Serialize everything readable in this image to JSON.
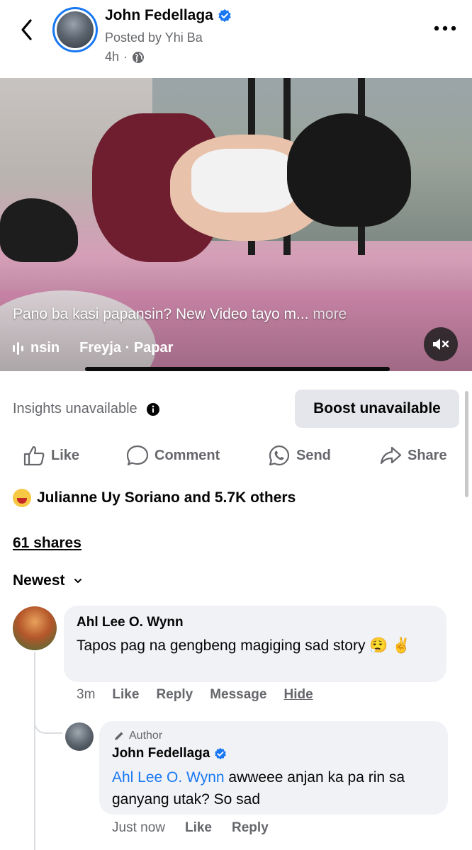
{
  "header": {
    "author_name": "John Fedellaga",
    "posted_by": "Posted by Yhi Ba",
    "time": "4h",
    "separator": "·",
    "icons": {
      "back": "chevron-left-icon",
      "verified": "verified-badge-icon",
      "audience": "globe-icon",
      "more": "more-horizontal-icon"
    }
  },
  "video": {
    "caption": "Pano ba kasi papansin? New Video tayo m...",
    "more_label": "more",
    "audio_track": "nsin",
    "audio_artist": "Freyja · Papar",
    "mute_icon": "volume-muted-icon"
  },
  "insights": {
    "label": "Insights unavailable",
    "boost_label": "Boost unavailable"
  },
  "actions": {
    "like": "Like",
    "comment": "Comment",
    "send": "Send",
    "share": "Share"
  },
  "engagement": {
    "reactions_text": "Julianne Uy Soriano and 5.7K others",
    "shares_text": "61 shares",
    "sort_label": "Newest"
  },
  "comments": [
    {
      "name": "Ahl Lee O. Wynn",
      "text": "Tapos pag na gengbeng magiging sad story 😮‍💨 ✌️",
      "time": "3m",
      "like": "Like",
      "reply": "Reply",
      "message": "Message",
      "hide": "Hide"
    }
  ],
  "reply": {
    "badge": "Author",
    "name": "John Fedellaga",
    "mention": "Ahl Lee O. Wynn",
    "text": " awweee anjan ka pa rin sa ganyang utak? So sad",
    "time": "Just now",
    "like": "Like",
    "reply": "Reply"
  },
  "colors": {
    "accent": "#1877f2",
    "muted": "#65676b",
    "bubble": "#f0f2f5",
    "button": "#e4e6eb"
  }
}
